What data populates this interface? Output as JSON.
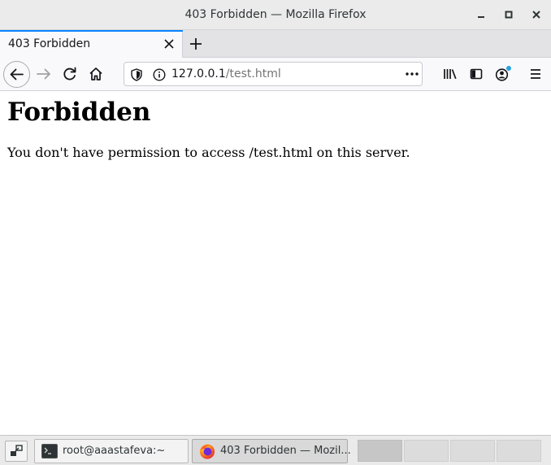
{
  "window": {
    "title": "403 Forbidden — Mozilla Firefox"
  },
  "tabs": [
    {
      "label": "403 Forbidden",
      "active": true
    }
  ],
  "navbar": {
    "url_host": "127.0.0.1",
    "url_path": "/test.html"
  },
  "page": {
    "heading": "Forbidden",
    "message": "You don't have permission to access /test.html on this server."
  },
  "taskbar": {
    "tasks": [
      {
        "label": "root@aaastafeva:~",
        "icon": "terminal-icon"
      },
      {
        "label": "403 Forbidden — Mozil...",
        "icon": "firefox-icon"
      }
    ],
    "workspaces": 4
  },
  "colors": {
    "accent": "#0a84ff",
    "sync_dot": "#29a2e0"
  }
}
